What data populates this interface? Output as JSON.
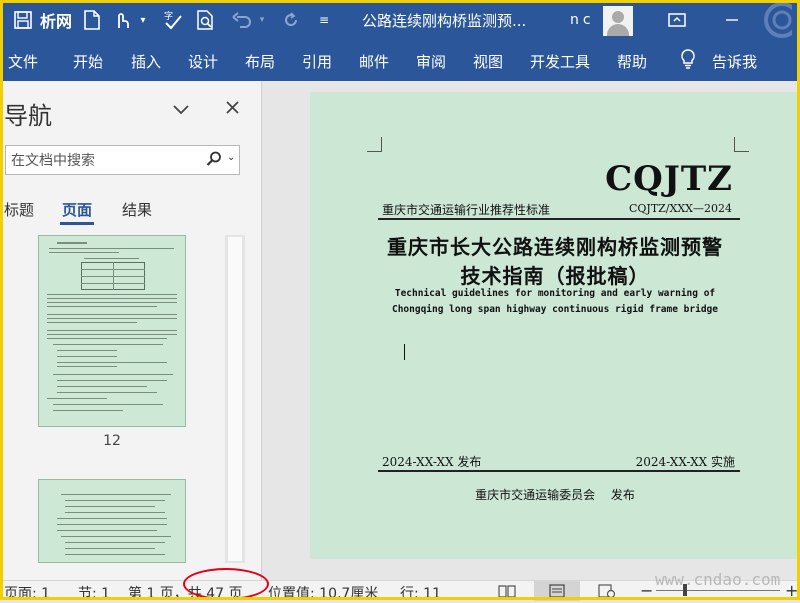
{
  "titlebar": {
    "logo_text": "析网",
    "title": "公路连续刚构桥监测预...",
    "user": "nc"
  },
  "ribbon": {
    "tabs": [
      "文件",
      "开始",
      "插入",
      "设计",
      "布局",
      "引用",
      "邮件",
      "审阅",
      "视图",
      "开发工具",
      "帮助"
    ],
    "tell_me": "告诉我"
  },
  "nav": {
    "title": "导航",
    "search_placeholder": "在文档中搜索",
    "tabs": [
      "标题",
      "页面",
      "结果"
    ],
    "active_tab": "页面",
    "thumb_page_number": "12"
  },
  "document": {
    "code_big": "CQJTZ",
    "standard_category": "重庆市交通运输行业推荐性标准",
    "standard_code": "CQJTZ/XXX—2024",
    "title_line1": "重庆市长大公路连续刚构桥监测预警",
    "title_line2": "技术指南（报批稿）",
    "english_line1": "Technical guidelines for monitoring and early warning of",
    "english_line2": "Chongqing long span highway continuous rigid frame bridge",
    "issue_date": "2024-XX-XX 发布",
    "impl_date": "2024-XX-XX 实施",
    "issuer": "重庆市交通运输委员会 发布"
  },
  "status": {
    "page": "页面: 1",
    "section": "节: 1",
    "page_of": "第 1 页，共 47 页",
    "position": "位置值: 10.7厘米",
    "line": "行: 11"
  },
  "watermark": "www.cndao.com",
  "colors": {
    "accent": "#2b579a",
    "page_bg": "#cce8d4",
    "highlight": "#e0001a",
    "frame": "#f0d000"
  },
  "icons": [
    "save-icon",
    "new-doc-icon",
    "touch-mode-icon",
    "spelling-icon",
    "search-doc-icon",
    "undo-icon",
    "redo-icon",
    "customize-icon",
    "ribbon-display-icon",
    "lightbulb-icon",
    "search-icon",
    "chevron-down-icon",
    "close-icon"
  ]
}
